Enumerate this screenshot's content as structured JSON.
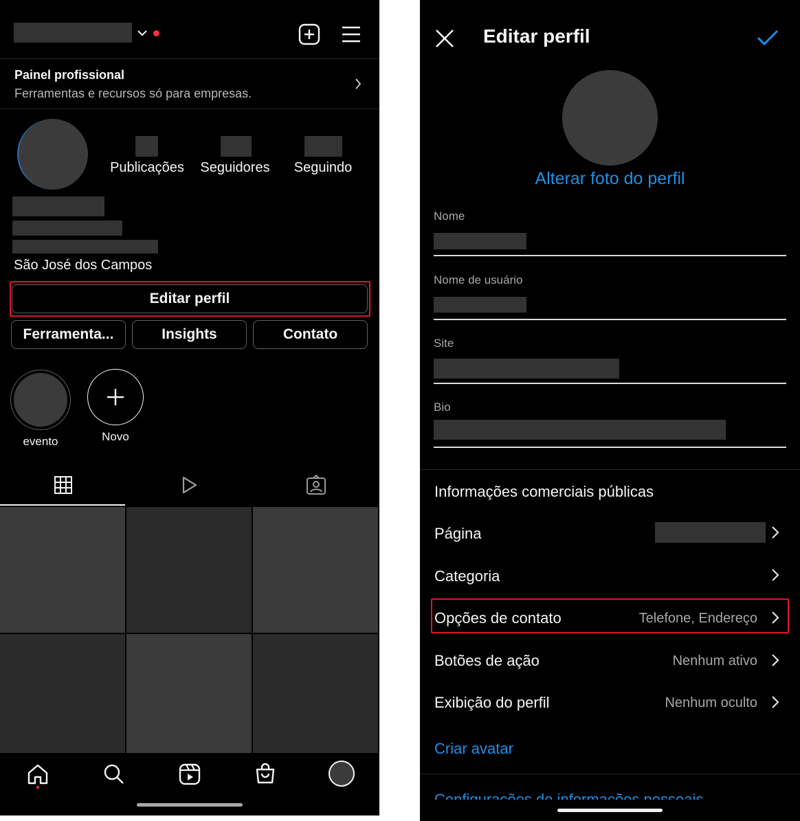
{
  "profile_screen": {
    "professional_panel": {
      "title": "Painel profissional",
      "subtitle": "Ferramentas e recursos só para empresas."
    },
    "stats": {
      "posts_label": "Publicações",
      "followers_label": "Seguidores",
      "following_label": "Seguindo"
    },
    "location": "São José dos Campos",
    "edit_profile_label": "Editar perfil",
    "action_buttons": [
      "Ferramenta...",
      "Insights",
      "Contato"
    ],
    "highlights": [
      {
        "label": "evento"
      },
      {
        "label": "Novo"
      }
    ],
    "tabs": [
      "grid-icon",
      "reels-icon",
      "tagged-icon"
    ],
    "bottom_nav": [
      "home-icon",
      "search-icon",
      "reels-icon",
      "shop-icon",
      "profile-avatar"
    ],
    "grid_tiles": [
      "#3b3b3b",
      "#2a2a2a",
      "#3b3b3b",
      "#2b2b2b",
      "#3b3b3b",
      "#2b2b2b"
    ]
  },
  "edit_screen": {
    "title": "Editar perfil",
    "change_photo_label": "Alterar foto do perfil",
    "fields": {
      "name_label": "Nome",
      "username_label": "Nome de usuário",
      "site_label": "Site",
      "bio_label": "Bio"
    },
    "section_title": "Informações comerciais públicas",
    "rows": {
      "page": {
        "title": "Página"
      },
      "category": {
        "title": "Categoria"
      },
      "contact": {
        "title": "Opções de contato",
        "value": "Telefone, Endereço"
      },
      "action_buttons": {
        "title": "Botões de ação",
        "value": "Nenhum ativo"
      },
      "profile_display": {
        "title": "Exibição do perfil",
        "value": "Nenhum oculto"
      }
    },
    "create_avatar_label": "Criar avatar",
    "personal_info_label": "Configurações de informações pessoais"
  },
  "colors": {
    "background": "#000000",
    "accent_blue": "#1e90e8",
    "highlight_red": "#e0142a",
    "placeholder_gray": "#333333"
  }
}
